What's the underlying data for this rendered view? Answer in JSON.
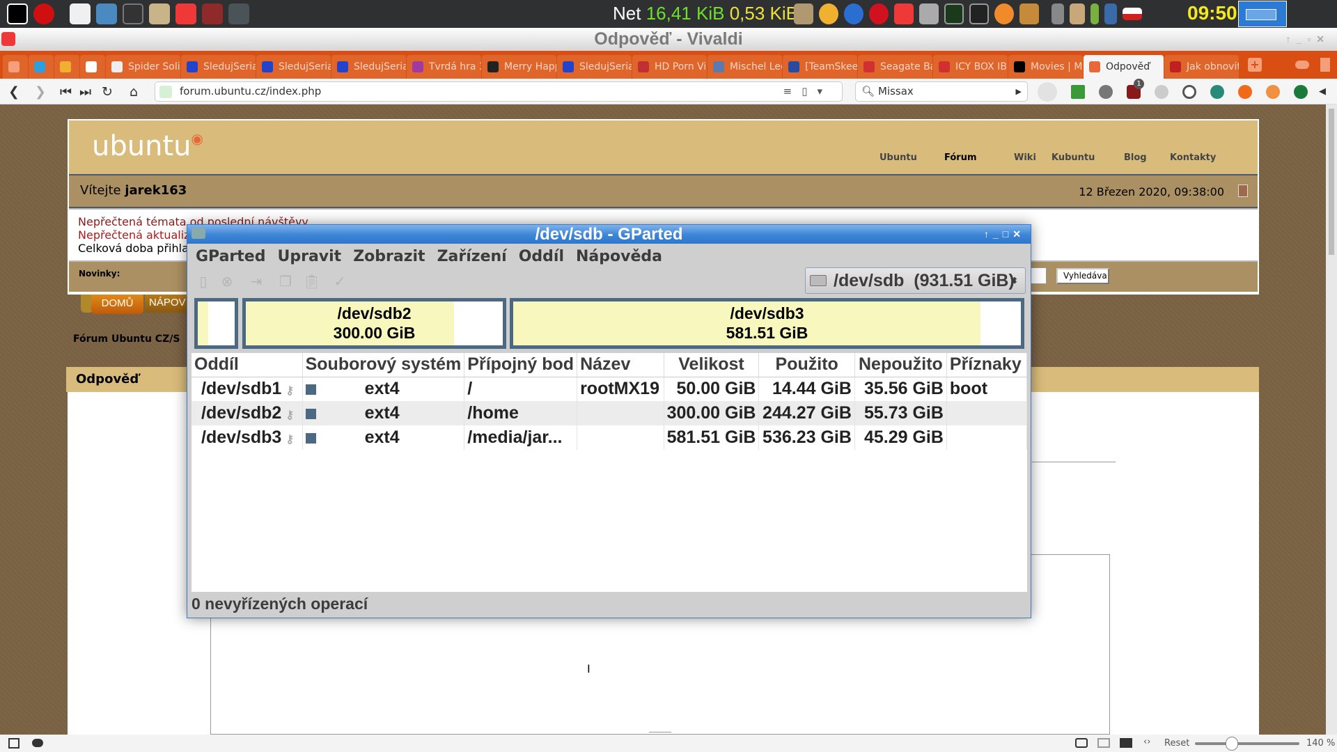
{
  "panel": {
    "net_label": "Net",
    "net_down": "16,41 KiB",
    "net_up": "0,53 KiB",
    "clock": "09:50",
    "launchers": [
      "x-icon",
      "stop-icon",
      "text-editor-icon",
      "gparted-icon",
      "terminal-icon",
      "folder-icon",
      "vivaldi-icon",
      "vivaldi-icon",
      "settings-icon"
    ],
    "tray": [
      "folder-icon",
      "weather-icon",
      "thunderbird-icon",
      "opera-icon",
      "vivaldi-icon",
      "package-icon",
      "system-monitor-icon",
      "terminal-icon",
      "shell-icon",
      "file-cabinet-icon",
      "volume-icon",
      "clipboard-icon",
      "battery-icon",
      "signal-icon",
      "czech-flag-icon"
    ]
  },
  "browser": {
    "title": "Odpověď - Vivaldi",
    "tabs": [
      {
        "label": "Spider Solit"
      },
      {
        "label": "SledujSeria"
      },
      {
        "label": "SledujSeria"
      },
      {
        "label": "SledujSeria"
      },
      {
        "label": "Tvrdá hra 3"
      },
      {
        "label": "Merry Happ"
      },
      {
        "label": "SledujSeria"
      },
      {
        "label": "HD Porn Vi"
      },
      {
        "label": "Mischel Lee"
      },
      {
        "label": "[TeamSkeet"
      },
      {
        "label": "Seagate Ba"
      },
      {
        "label": "ICY BOX IB"
      },
      {
        "label": "Movies | Mi"
      },
      {
        "label": "Odpověď",
        "active": true
      },
      {
        "label": "Jak obnovit"
      }
    ],
    "url": "forum.ubuntu.cz/index.php",
    "search_value": "Missax",
    "ext_badge": "1",
    "status": {
      "reset": "Reset",
      "zoom": "140 %",
      "zoom_fraction": 0.35
    }
  },
  "forum": {
    "logo": "ubuntu",
    "nav": [
      "Ubuntu",
      "Fórum",
      "Wiki",
      "Kubuntu",
      "Blog",
      "Kontakty"
    ],
    "welcome_prefix": "Vítejte",
    "username": "jarek163",
    "date": "12 Březen 2020, 09:38:00",
    "info": [
      "Nepřečtená témata od poslední návštěvy",
      "Nepřečtená aktualiz",
      "Celková doba přihla"
    ],
    "news_label": "Novinky:",
    "search_button": "Vyhledáva",
    "tabs": [
      "DOMŮ",
      "NÁPOV"
    ],
    "breadcrumb": "Fórum Ubuntu CZ/S",
    "reply_header": "Odpověď"
  },
  "gparted": {
    "title": "/dev/sdb - GParted",
    "menu": [
      "GParted",
      "Upravit",
      "Zobrazit",
      "Zařízení",
      "Oddíl",
      "Nápověda"
    ],
    "device": "/dev/sdb  (931.51 GiB)",
    "graph": [
      {
        "name": "",
        "size": "",
        "used_fraction": 0.29
      },
      {
        "name": "/dev/sdb2",
        "size": "300.00 GiB",
        "used_fraction": 0.81
      },
      {
        "name": "/dev/sdb3",
        "size": "581.51 GiB",
        "used_fraction": 0.92
      }
    ],
    "columns": [
      "Oddíl",
      "Souborový systém",
      "Přípojný bod",
      "Název",
      "Velikost",
      "Použito",
      "Nepoužito",
      "Příznaky"
    ],
    "rows": [
      {
        "partition": "/dev/sdb1",
        "fs": "ext4",
        "mount": "/",
        "name": "rootMX19",
        "size": "50.00 GiB",
        "used": "14.44 GiB",
        "unused": "35.56 GiB",
        "flags": "boot"
      },
      {
        "partition": "/dev/sdb2",
        "fs": "ext4",
        "mount": "/home",
        "name": "",
        "size": "300.00 GiB",
        "used": "244.27 GiB",
        "unused": "55.73 GiB",
        "flags": ""
      },
      {
        "partition": "/dev/sdb3",
        "fs": "ext4",
        "mount": "/media/jar...",
        "name": "",
        "size": "581.51 GiB",
        "used": "536.23 GiB",
        "unused": "45.29 GiB",
        "flags": ""
      }
    ],
    "fs_color": "#4b6983",
    "status": "0 nevyřízených operací"
  }
}
